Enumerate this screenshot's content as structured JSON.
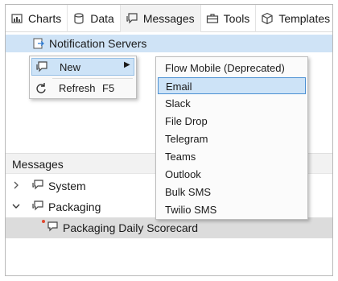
{
  "tabs": [
    {
      "label": "Charts",
      "icon": "chart-icon",
      "active": false
    },
    {
      "label": "Data",
      "icon": "database-icon",
      "active": false
    },
    {
      "label": "Messages",
      "icon": "message-icon",
      "active": true
    },
    {
      "label": "Tools",
      "icon": "toolbox-icon",
      "active": false
    },
    {
      "label": "Templates",
      "icon": "cube-icon",
      "active": false
    }
  ],
  "tree_top": {
    "selected_item": "Notification Servers"
  },
  "context_menu": {
    "new_label": "New",
    "refresh_label": "Refresh",
    "refresh_shortcut": "F5"
  },
  "submenu": {
    "items": [
      "Flow Mobile (Deprecated)",
      "Email",
      "Slack",
      "File Drop",
      "Telegram",
      "Teams",
      "Outlook",
      "Bulk SMS",
      "Twilio SMS"
    ],
    "highlighted": "Email"
  },
  "messages_section": {
    "title": "Messages",
    "items": [
      {
        "label": "System",
        "expanded": false
      },
      {
        "label": "Packaging",
        "expanded": true
      },
      {
        "label": "Packaging Daily Scorecard",
        "child": true,
        "selected": true
      }
    ]
  },
  "colors": {
    "selection": "#cfe3f6",
    "highlight_border": "#4a8fd3",
    "badge": "#e0472f"
  }
}
